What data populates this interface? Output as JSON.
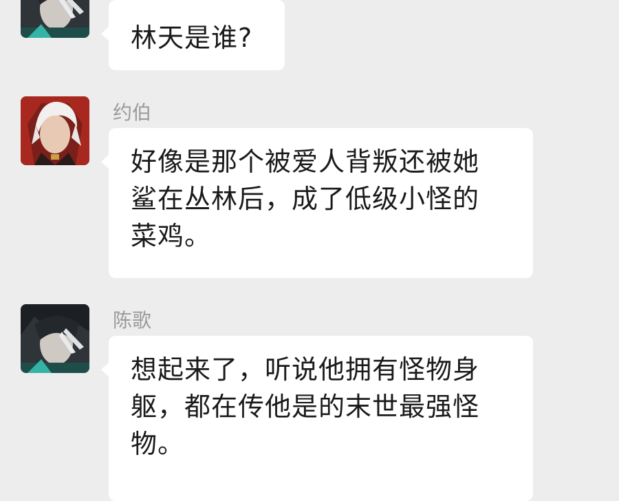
{
  "colors": {
    "background": "#ededed",
    "bubble": "#ffffff",
    "sender_name": "#9a9a9a",
    "message_text": "#1a1a1a"
  },
  "messages": [
    {
      "sender": "",
      "avatar_icon": "dark-haired-man-avatar-icon",
      "text": "林天是谁?"
    },
    {
      "sender": "约伯",
      "avatar_icon": "white-haired-man-avatar-icon",
      "lines": [
        "好像是那个被爱人背叛还被她",
        "鲨在丛林后，成了低级小怪的",
        "菜鸡。"
      ]
    },
    {
      "sender": "陈歌",
      "avatar_icon": "dark-haired-man-avatar-icon",
      "lines": [
        "想起来了，听说他拥有怪物身",
        "躯，都在传他是的末世最强怪",
        "物。"
      ]
    }
  ]
}
